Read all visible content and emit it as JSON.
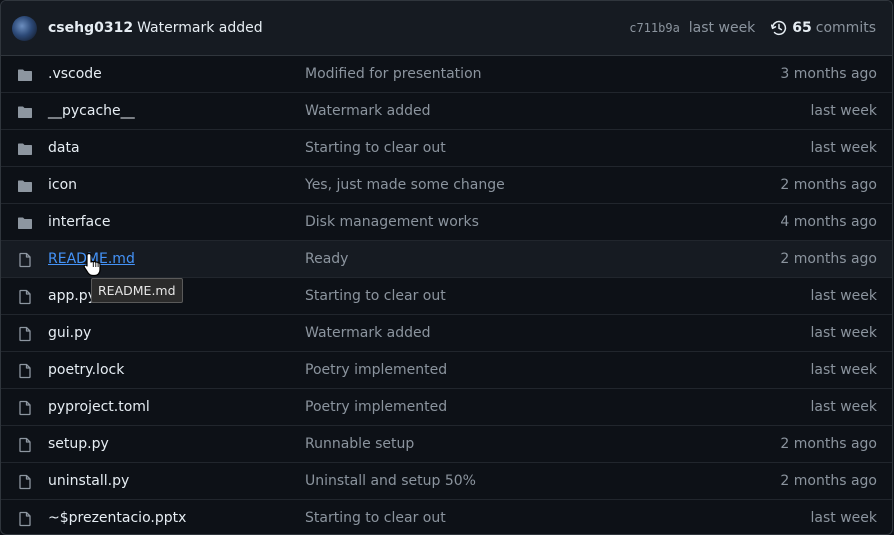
{
  "commit": {
    "author": "csehg0312",
    "message": "Watermark added",
    "sha": "c711b9a",
    "when": "last week",
    "commit_count": "65",
    "commits_label": "commits",
    "history_icon": "history-icon"
  },
  "files": [
    {
      "name": ".vscode",
      "type": "folder",
      "message": "Modified for presentation",
      "age": "3 months ago"
    },
    {
      "name": "__pycache__",
      "type": "folder",
      "message": "Watermark added",
      "age": "last week"
    },
    {
      "name": "data",
      "type": "folder",
      "message": "Starting to clear out",
      "age": "last week"
    },
    {
      "name": "icon",
      "type": "folder",
      "message": "Yes, just made some change",
      "age": "2 months ago"
    },
    {
      "name": "interface",
      "type": "folder",
      "message": "Disk management works",
      "age": "4 months ago"
    },
    {
      "name": "README.md",
      "type": "file",
      "message": "Ready",
      "age": "2 months ago"
    },
    {
      "name": "app.py",
      "type": "file",
      "message": "Starting to clear out",
      "age": "last week"
    },
    {
      "name": "gui.py",
      "type": "file",
      "message": "Watermark added",
      "age": "last week"
    },
    {
      "name": "poetry.lock",
      "type": "file",
      "message": "Poetry implemented",
      "age": "last week"
    },
    {
      "name": "pyproject.toml",
      "type": "file",
      "message": "Poetry implemented",
      "age": "last week"
    },
    {
      "name": "setup.py",
      "type": "file",
      "message": "Runnable setup",
      "age": "2 months ago"
    },
    {
      "name": "uninstall.py",
      "type": "file",
      "message": "Uninstall and setup 50%",
      "age": "2 months ago"
    },
    {
      "name": "~$prezentacio.pptx",
      "type": "file",
      "message": "Starting to clear out",
      "age": "last week"
    }
  ],
  "tooltip": {
    "text": "README.md"
  },
  "colors": {
    "background": "#0d1117",
    "header_bg": "#161b22",
    "border": "#30363d",
    "text": "#e6edf3",
    "muted": "#8b949e",
    "link": "#4493f8"
  }
}
